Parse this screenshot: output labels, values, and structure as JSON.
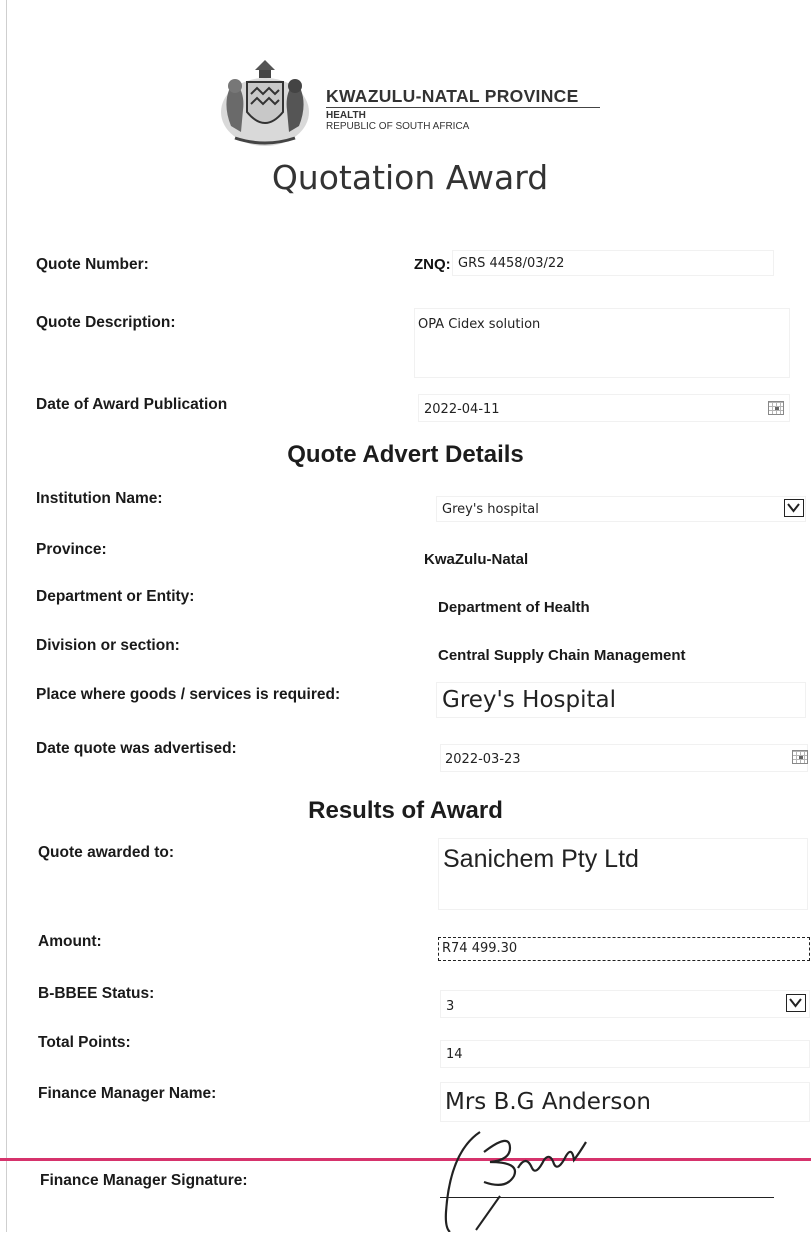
{
  "header": {
    "province": "KWAZULU-NATAL PROVINCE",
    "department": "HEALTH",
    "country": "REPUBLIC OF SOUTH AFRICA"
  },
  "title": "Quotation Award",
  "quote": {
    "number_label": "Quote Number:",
    "number_prefix": "ZNQ:",
    "number_value": "GRS 4458/03/22",
    "description_label": "Quote Description:",
    "description_value": "OPA Cidex solution",
    "award_date_label": "Date of Award Publication",
    "award_date_value": "2022-04-11"
  },
  "advert": {
    "heading": "Quote Advert Details",
    "institution_label": "Institution Name:",
    "institution_value": "Grey's hospital",
    "province_label": "Province:",
    "province_value": "KwaZulu-Natal",
    "department_label": "Department or Entity:",
    "department_value": "Department of Health",
    "division_label": "Division or section:",
    "division_value": "Central Supply Chain Management",
    "place_label": "Place where goods /  services is required:",
    "place_value": "Grey's Hospital",
    "advertised_label": "Date quote was advertised:",
    "advertised_value": "2022-03-23"
  },
  "results": {
    "heading": "Results of Award",
    "awarded_label": "Quote awarded to:",
    "awarded_value": "Sanichem Pty Ltd",
    "amount_label": "Amount:",
    "amount_value": "R74 499.30",
    "bbbee_label": "B-BBEE Status:",
    "bbbee_value": "3",
    "points_label": "Total Points:",
    "points_value": "14",
    "fm_name_label": "Finance Manager Name:",
    "fm_name_value": "Mrs B.G Anderson",
    "fm_signature_label": "Finance Manager Signature:"
  },
  "colors": {
    "red_line": "#d6336c",
    "logo_ink": "#333333"
  },
  "icons": {
    "calendar": "calendar-icon",
    "dropdown": "chevron-down-icon",
    "coat_of_arms": "kzn-coat-of-arms-logo"
  }
}
